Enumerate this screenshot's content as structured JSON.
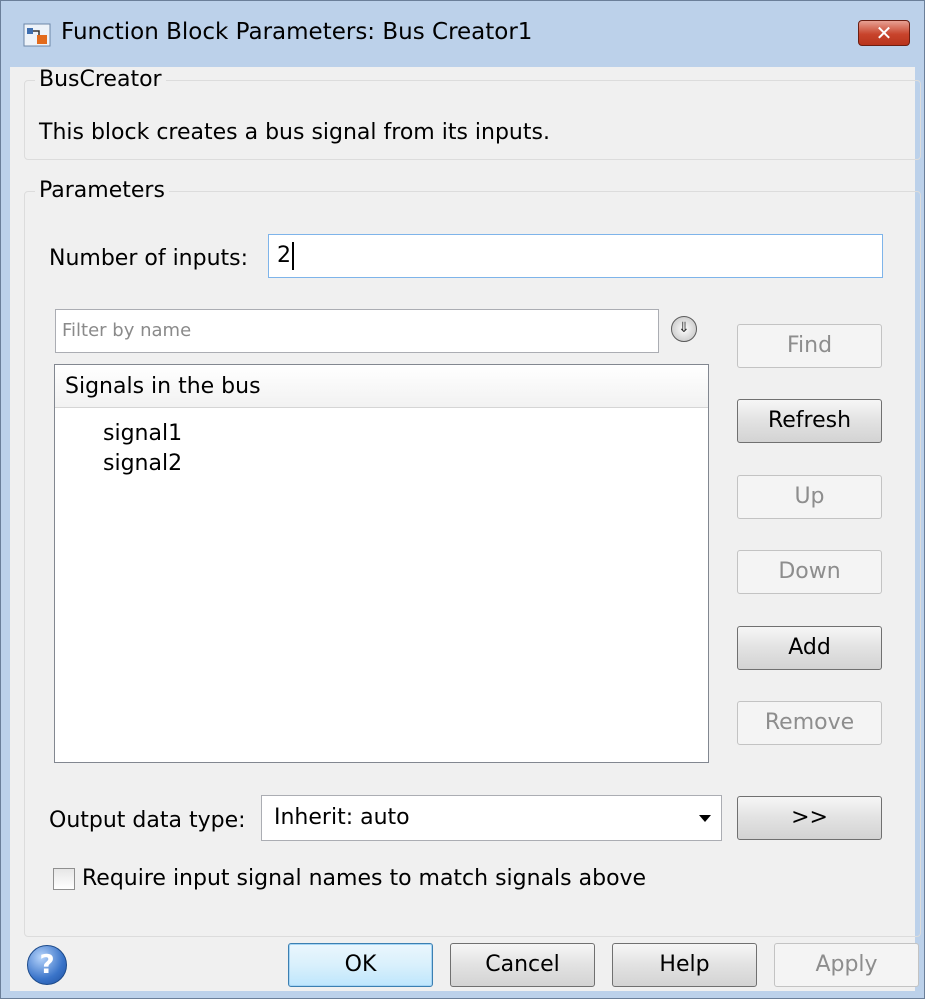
{
  "window": {
    "title": "Function Block Parameters: Bus Creator1",
    "close_label": "✕"
  },
  "block_group": {
    "title": "BusCreator",
    "description": "This block creates a bus signal from its inputs."
  },
  "params_group": {
    "title": "Parameters",
    "num_inputs_label": "Number of inputs:",
    "num_inputs_value": "2",
    "filter_placeholder": "Filter by name",
    "signals_header": "Signals in the bus",
    "signals": [
      "signal1",
      "signal2"
    ],
    "output_type_label": "Output data type:",
    "output_type_value": "Inherit: auto",
    "require_names_label": "Require input signal names to match signals above",
    "require_names_checked": false
  },
  "side_buttons": {
    "find": "Find",
    "refresh": "Refresh",
    "up": "Up",
    "down": "Down",
    "add": "Add",
    "remove": "Remove",
    "assistant": ">>"
  },
  "footer": {
    "ok": "OK",
    "cancel": "Cancel",
    "help": "Help",
    "apply": "Apply"
  },
  "icons": {
    "expand": "double-chevron-down-icon",
    "help": "question-mark-icon"
  }
}
